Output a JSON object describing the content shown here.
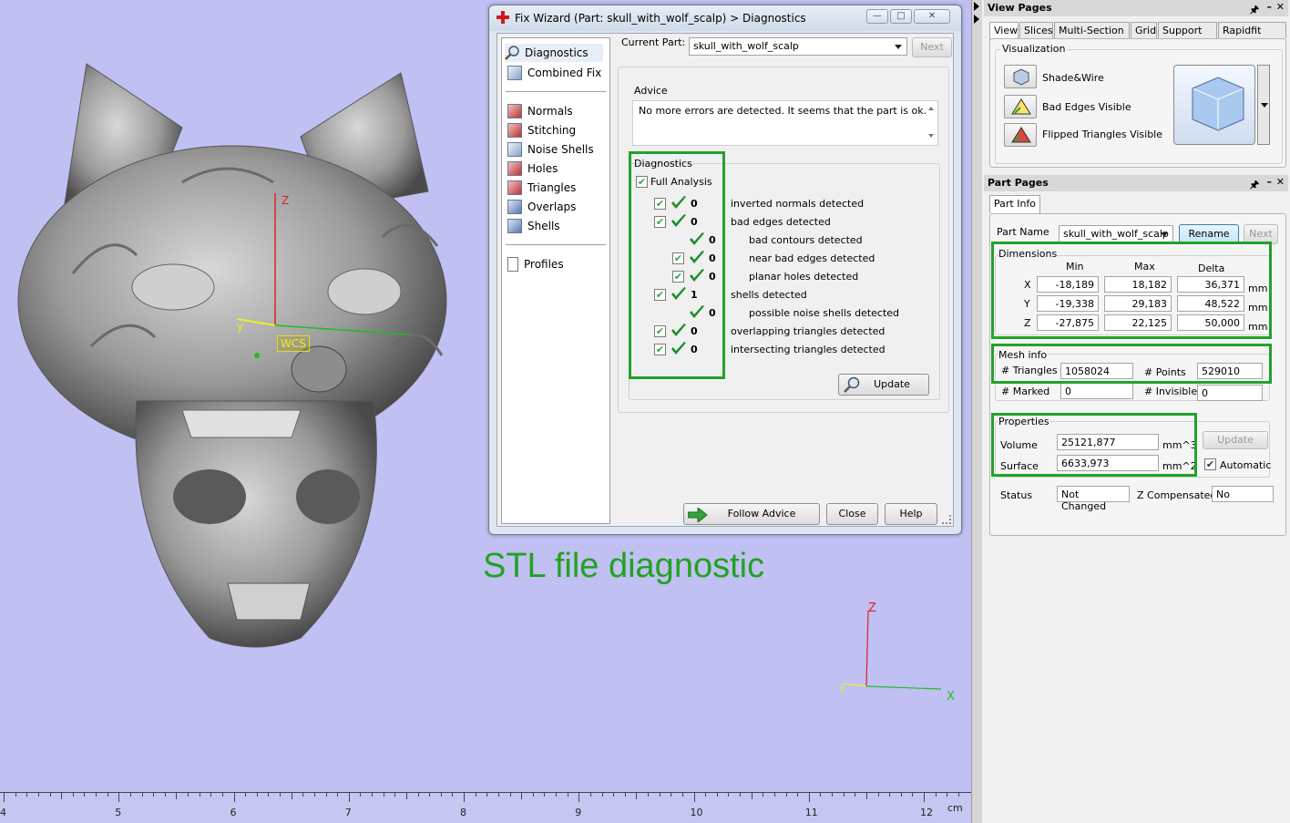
{
  "fix_wizard": {
    "title": "Fix Wizard (Part: skull_with_wolf_scalp) > Diagnostics",
    "nav_top": [
      "Diagnostics",
      "Combined Fix"
    ],
    "nav_mid": [
      "Normals",
      "Stitching",
      "Noise Shells",
      "Holes",
      "Triangles",
      "Overlaps",
      "Shells"
    ],
    "nav_bottom": [
      "Profiles"
    ],
    "current_part_label": "Current Part:",
    "current_part_value": "skull_with_wolf_scalp",
    "next_label": "Next",
    "advice_label": "Advice",
    "advice_text": "No more errors are detected. It seems that the part is ok.",
    "diag_label": "Diagnostics",
    "full_analysis": "Full Analysis",
    "rows": [
      {
        "count": "0",
        "label": "inverted normals detected",
        "indent": 0
      },
      {
        "count": "0",
        "label": "bad edges detected",
        "indent": 0
      },
      {
        "count": "0",
        "label": "bad contours detected",
        "indent": 1
      },
      {
        "count": "0",
        "label": "near bad edges detected",
        "indent": 1
      },
      {
        "count": "0",
        "label": "planar holes detected",
        "indent": 1
      },
      {
        "count": "1",
        "label": "shells detected",
        "indent": 0
      },
      {
        "count": "0",
        "label": "possible noise shells detected",
        "indent": 1
      },
      {
        "count": "0",
        "label": "overlapping triangles detected",
        "indent": 0
      },
      {
        "count": "0",
        "label": "intersecting triangles detected",
        "indent": 0
      }
    ],
    "update_label": "Update",
    "follow_advice": "Follow Advice",
    "close": "Close",
    "help": "Help"
  },
  "annotation": "STL file diagnostic",
  "viewport": {
    "wcs": "WCS",
    "axis_z": "Z",
    "axis_y": "y",
    "axis_x": "X",
    "ruler": [
      "4",
      "5",
      "6",
      "7",
      "8",
      "9",
      "10",
      "11",
      "12"
    ],
    "ruler_unit": "cm"
  },
  "view_pages": {
    "title": "View Pages",
    "tabs": [
      "View",
      "Slices",
      "Multi-Section",
      "Grid",
      "Support View",
      "Rapidfit View"
    ],
    "visualization": "Visualization",
    "items": [
      "Shade&Wire",
      "Bad Edges Visible",
      "Flipped Triangles Visible"
    ]
  },
  "part_pages": {
    "title": "Part Pages",
    "tab": "Part Info",
    "part_name_label": "Part Name",
    "part_name": "skull_with_wolf_scalp",
    "rename": "Rename",
    "next": "Next",
    "dimensions": "Dimensions",
    "col_min": "Min",
    "col_max": "Max",
    "col_delta": "Delta",
    "dims": [
      {
        "axis": "X",
        "min": "-18,189",
        "max": "18,182",
        "delta": "36,371",
        "unit": "mm"
      },
      {
        "axis": "Y",
        "min": "-19,338",
        "max": "29,183",
        "delta": "48,522",
        "unit": "mm"
      },
      {
        "axis": "Z",
        "min": "-27,875",
        "max": "22,125",
        "delta": "50,000",
        "unit": "mm"
      }
    ],
    "mesh_info": "Mesh info",
    "triangles_label": "# Triangles",
    "triangles": "1058024",
    "points_label": "# Points",
    "points": "529010",
    "marked_label": "# Marked",
    "marked": "0",
    "invisible_label": "# Invisible",
    "invisible": "0",
    "properties": "Properties",
    "volume_label": "Volume",
    "volume": "25121,877",
    "volume_unit": "mm^3",
    "surface_label": "Surface",
    "surface": "6633,973",
    "surface_unit": "mm^2",
    "update": "Update",
    "automatic": "Automatic",
    "status_label": "Status",
    "status": "Not Changed",
    "zcomp_label": "Z Compensated",
    "zcomp": "No"
  }
}
